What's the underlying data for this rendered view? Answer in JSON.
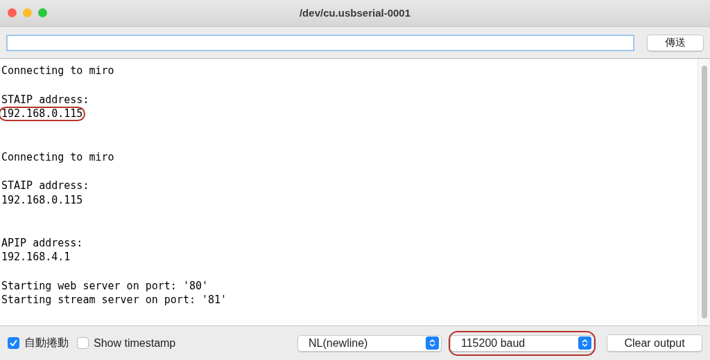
{
  "window": {
    "title": "/dev/cu.usbserial-0001"
  },
  "send_bar": {
    "button": "傳送"
  },
  "output": [
    {
      "kind": "text",
      "text": "Connecting to miro",
      "highlighted": false
    },
    {
      "kind": "blank"
    },
    {
      "kind": "text",
      "text": "STAIP address:",
      "highlighted": false
    },
    {
      "kind": "text",
      "text": "192.168.0.115",
      "highlighted": true
    },
    {
      "kind": "blank"
    },
    {
      "kind": "blank"
    },
    {
      "kind": "text",
      "text": "Connecting to miro",
      "highlighted": false
    },
    {
      "kind": "blank"
    },
    {
      "kind": "text",
      "text": "STAIP address:",
      "highlighted": false
    },
    {
      "kind": "text",
      "text": "192.168.0.115",
      "highlighted": false
    },
    {
      "kind": "blank"
    },
    {
      "kind": "blank"
    },
    {
      "kind": "text",
      "text": "APIP address:",
      "highlighted": false
    },
    {
      "kind": "text",
      "text": "192.168.4.1",
      "highlighted": false
    },
    {
      "kind": "blank"
    },
    {
      "kind": "text",
      "text": "Starting web server on port: '80'",
      "highlighted": false
    },
    {
      "kind": "text",
      "text": "Starting stream server on port: '81'",
      "highlighted": false
    }
  ],
  "bottom_bar": {
    "checkboxes": [
      {
        "label": "自動捲動",
        "checked": true
      },
      {
        "label": "Show timestamp",
        "checked": false
      }
    ],
    "selects": [
      {
        "value": "NL(newline)",
        "highlighted": false
      },
      {
        "value": "115200 baud",
        "highlighted": true
      }
    ],
    "clear_button": "Clear output"
  }
}
